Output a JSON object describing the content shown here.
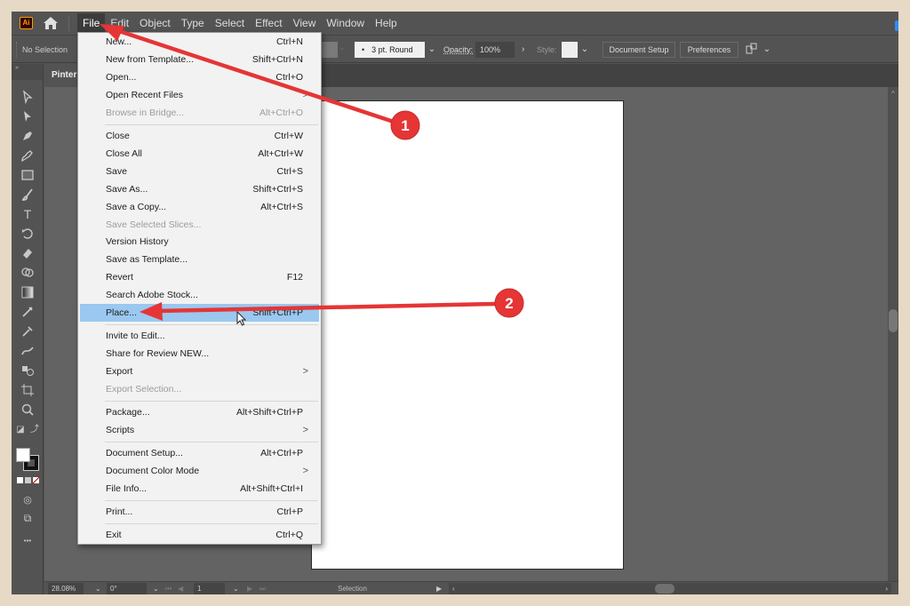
{
  "app": {
    "logo_text": "Ai",
    "menus": [
      "File",
      "Edit",
      "Object",
      "Type",
      "Select",
      "Effect",
      "View",
      "Window",
      "Help"
    ],
    "active_menu": "File"
  },
  "controlbar": {
    "selection_status": "No Selection",
    "brush": "3 pt. Round",
    "opacity_label": "Opacity:",
    "opacity_value": "100%",
    "style_label": "Style:",
    "document_setup_button": "Document Setup",
    "preferences_button": "Preferences"
  },
  "document": {
    "tab_title": "Pinter"
  },
  "file_menu": {
    "items": [
      {
        "label": "New...",
        "shortcut": "Ctrl+N"
      },
      {
        "label": "New from Template...",
        "shortcut": "Shift+Ctrl+N"
      },
      {
        "label": "Open...",
        "shortcut": "Ctrl+O"
      },
      {
        "label": "Open Recent Files",
        "submenu": true
      },
      {
        "label": "Browse in Bridge...",
        "shortcut": "Alt+Ctrl+O",
        "disabled": true
      },
      {
        "label": "Close",
        "shortcut": "Ctrl+W"
      },
      {
        "label": "Close All",
        "shortcut": "Alt+Ctrl+W"
      },
      {
        "label": "Save",
        "shortcut": "Ctrl+S"
      },
      {
        "label": "Save As...",
        "shortcut": "Shift+Ctrl+S"
      },
      {
        "label": "Save a Copy...",
        "shortcut": "Alt+Ctrl+S"
      },
      {
        "label": "Save Selected Slices...",
        "disabled": true
      },
      {
        "label": "Version History"
      },
      {
        "label": "Save as Template..."
      },
      {
        "label": "Revert",
        "shortcut": "F12"
      },
      {
        "label": "Search Adobe Stock..."
      },
      {
        "label": "Place...",
        "shortcut": "Shift+Ctrl+P",
        "highlighted": true
      },
      {
        "label": "Invite to Edit..."
      },
      {
        "label": "Share for Review NEW..."
      },
      {
        "label": "Export",
        "submenu": true
      },
      {
        "label": "Export Selection...",
        "disabled": true
      },
      {
        "label": "Package...",
        "shortcut": "Alt+Shift+Ctrl+P"
      },
      {
        "label": "Scripts",
        "submenu": true
      },
      {
        "label": "Document Setup...",
        "shortcut": "Alt+Ctrl+P"
      },
      {
        "label": "Document Color Mode",
        "submenu": true
      },
      {
        "label": "File Info...",
        "shortcut": "Alt+Shift+Ctrl+I"
      },
      {
        "label": "Print...",
        "shortcut": "Ctrl+P"
      },
      {
        "label": "Exit",
        "shortcut": "Ctrl+Q"
      }
    ],
    "submenu_glyph": ">"
  },
  "statusbar": {
    "zoom": "28.08%",
    "rotation": "0°",
    "artboard_number": "1",
    "current_tool": "Selection"
  },
  "annotations": {
    "color": "#e53535",
    "steps": [
      "1",
      "2"
    ]
  },
  "icons": {
    "chevron_down": "⌄",
    "chevron_right": "›",
    "chevron_left": "‹",
    "play": "▶",
    "more": "•••"
  }
}
